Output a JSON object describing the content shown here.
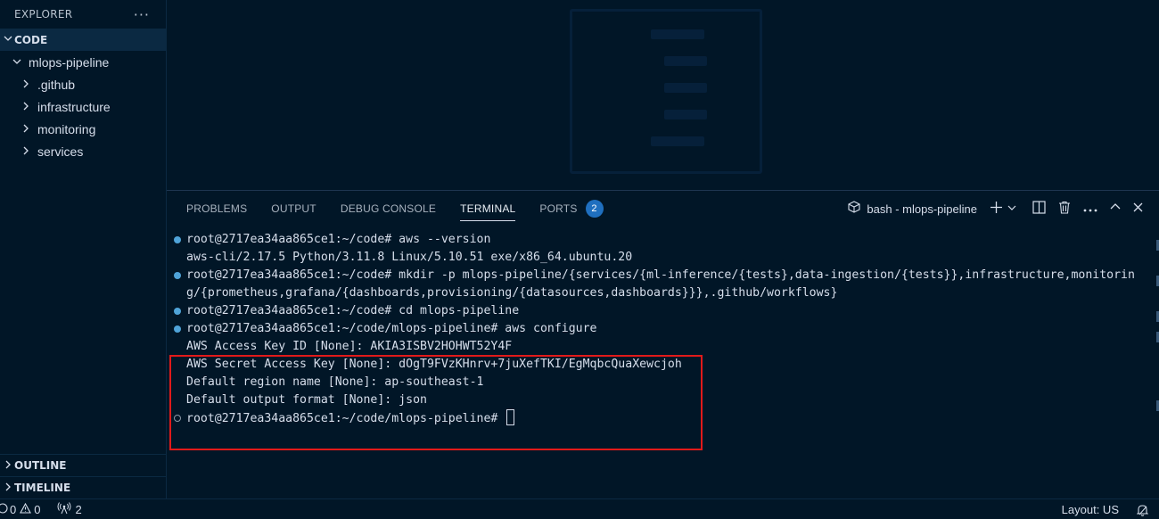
{
  "sidebar": {
    "header": "EXPLORER",
    "more": "···",
    "section_code": "CODE",
    "tree": {
      "root": "mlops-pipeline",
      "folders": [
        ".github",
        "infrastructure",
        "monitoring",
        "services"
      ]
    },
    "outline": "OUTLINE",
    "timeline": "TIMELINE"
  },
  "panel": {
    "tabs": {
      "problems": "PROBLEMS",
      "output": "OUTPUT",
      "debug": "DEBUG CONSOLE",
      "terminal": "TERMINAL",
      "ports": "PORTS"
    },
    "ports_badge": "2",
    "terminal_name": "bash - mlops-pipeline"
  },
  "terminal": {
    "lines": [
      "root@2717ea34aa865ce1:~/code# aws --version",
      "aws-cli/2.17.5 Python/3.11.8 Linux/5.10.51 exe/x86_64.ubuntu.20",
      "root@2717ea34aa865ce1:~/code# mkdir -p mlops-pipeline/{services/{ml-inference/{tests},data-ingestion/{tests}},infrastructure,monitorin",
      "g/{prometheus,grafana/{dashboards,provisioning/{datasources,dashboards}}},.github/workflows}",
      "root@2717ea34aa865ce1:~/code# cd mlops-pipeline",
      "root@2717ea34aa865ce1:~/code/mlops-pipeline# aws configure",
      "AWS Access Key ID [None]: AKIA3ISBV2HOHWT52Y4F",
      "AWS Secret Access Key [None]: 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",
      "Default region name [None]: ap-southeast-1",
      "Default output format [None]: json",
      "root@2717ea34aa865ce1:~/code/mlops-pipeline# "
    ]
  },
  "statusbar": {
    "errors": "0",
    "warnings": "0",
    "ports": "2",
    "layout": "Layout: US"
  },
  "colors": {
    "background": "#011627",
    "highlight": "#e11a1a",
    "badge": "#1f6fbf"
  }
}
